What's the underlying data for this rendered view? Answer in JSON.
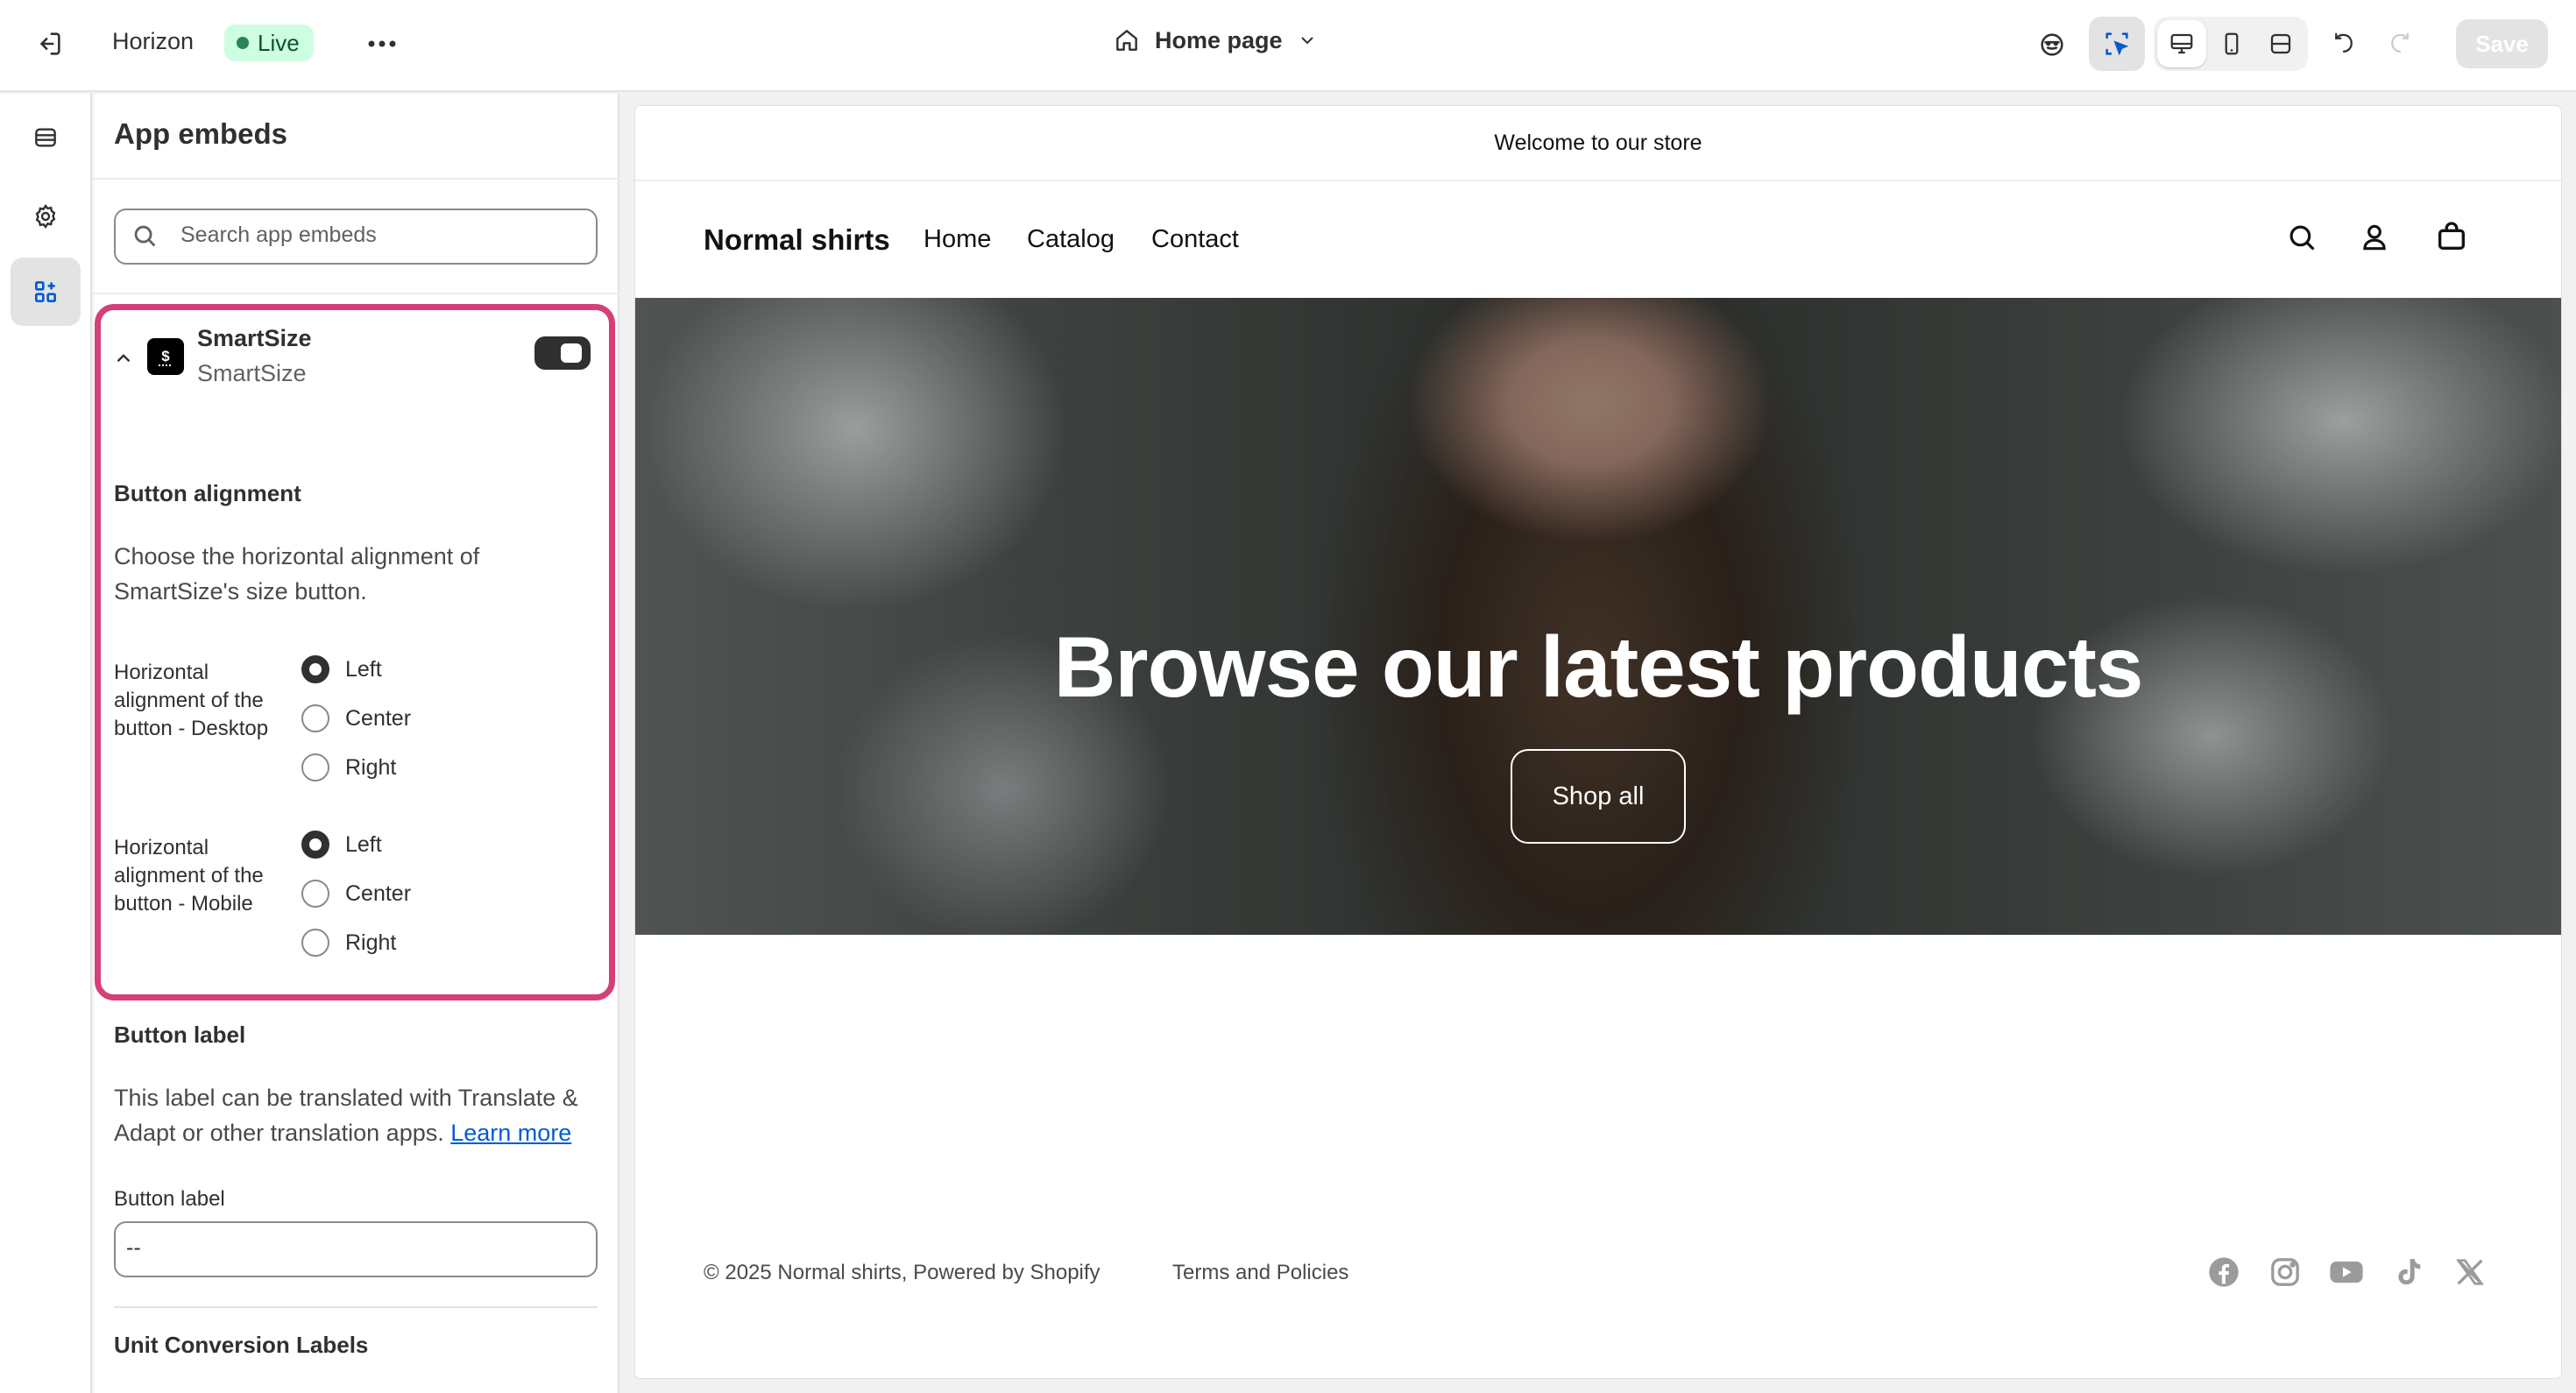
{
  "topbar": {
    "store_name": "Horizon",
    "live_badge": "Live",
    "page_selector": "Home page",
    "save_label": "Save"
  },
  "panel": {
    "title": "App embeds",
    "search_placeholder": "Search app embeds",
    "app": {
      "name": "SmartSize",
      "subtitle": "SmartSize",
      "enabled": true
    },
    "button_alignment": {
      "title": "Button alignment",
      "description_line1": "Choose the horizontal alignment of",
      "description_line2": "SmartSize's size button.",
      "desktop": {
        "label_line1": "Horizontal",
        "label_line2": "alignment of the",
        "label_line3": "button - Desktop",
        "options": [
          "Left",
          "Center",
          "Right"
        ],
        "selected": "Left"
      },
      "mobile": {
        "label_line1": "Horizontal",
        "label_line2": "alignment of the",
        "label_line3": "button - Mobile",
        "options": [
          "Left",
          "Center",
          "Right"
        ],
        "selected": "Left"
      }
    },
    "button_label_section": {
      "title": "Button label",
      "description_line1": "This label can be translated with Translate &",
      "description_line2": "Adapt or other translation apps.",
      "learn_more": "Learn more",
      "field_label": "Button label",
      "field_value": "--"
    },
    "unit_conversion_title": "Unit Conversion Labels"
  },
  "preview": {
    "announcement": "Welcome to our store",
    "brand": "Normal shirts",
    "nav": [
      "Home",
      "Catalog",
      "Contact"
    ],
    "hero_title": "Browse our latest products",
    "hero_button": "Shop all",
    "footer_copyright": "© 2025 Normal shirts, Powered by Shopify",
    "footer_link": "Terms and Policies"
  },
  "colors": {
    "highlight": "#d63f77",
    "live_bg": "#cdfee1",
    "link": "#005bd3"
  }
}
